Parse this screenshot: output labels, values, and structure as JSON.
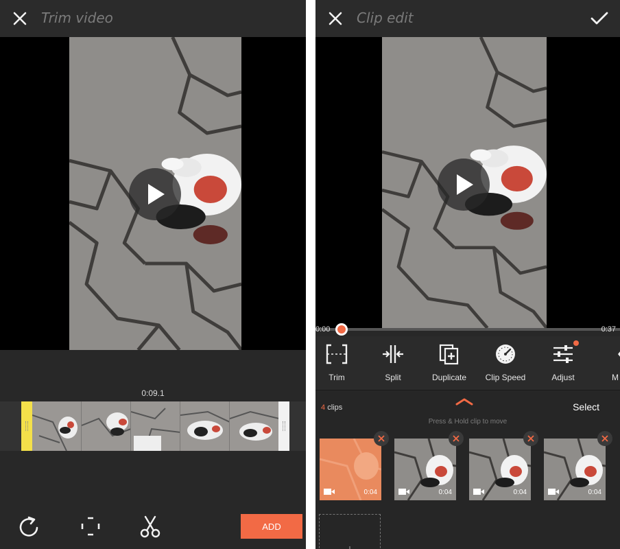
{
  "trim_screen": {
    "title": "Trim video",
    "timestamp": "0:09.1",
    "add_label": "ADD",
    "icons": {
      "close": "close-icon",
      "play": "play-icon",
      "rotate": "rotate-icon",
      "fullscreen": "fullscreen-icon",
      "scissors": "scissors-icon"
    }
  },
  "clip_edit_screen": {
    "title": "Clip edit",
    "time_start": "0:00",
    "time_end": "0:37",
    "playback_progress": 0,
    "tools": [
      {
        "label": "Trim",
        "icon": "trim-icon"
      },
      {
        "label": "Split",
        "icon": "split-icon"
      },
      {
        "label": "Duplicate",
        "icon": "duplicate-icon"
      },
      {
        "label": "Clip Speed",
        "icon": "speed-icon"
      },
      {
        "label": "Adjust",
        "icon": "adjust-icon"
      },
      {
        "label": "M",
        "icon": "more-icon"
      }
    ],
    "clips_count": "4",
    "clips_label": "clips",
    "select_label": "Select",
    "hint": "Press & Hold clip to move",
    "clips": [
      {
        "duration": "0:04",
        "selected": true
      },
      {
        "duration": "0:04",
        "selected": false
      },
      {
        "duration": "0:04",
        "selected": false
      },
      {
        "duration": "0:04",
        "selected": false
      }
    ]
  },
  "colors": {
    "accent": "#f26a45",
    "trim_handle": "#f4e04a",
    "panel_bg": "#282828"
  }
}
